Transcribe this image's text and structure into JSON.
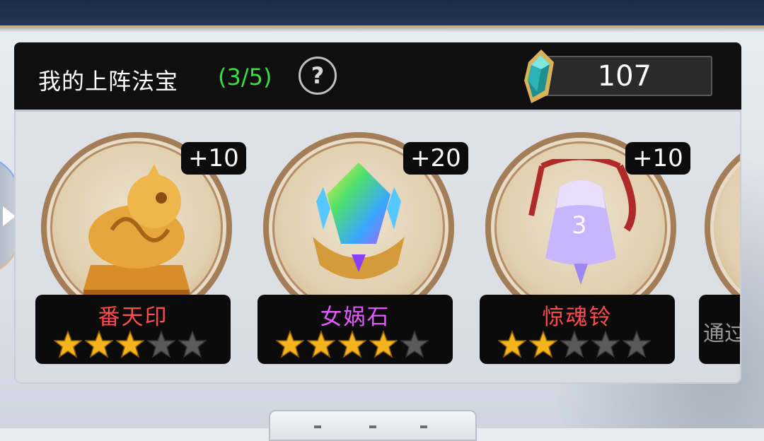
{
  "header": {
    "title": "我的上阵法宝",
    "count": "(3/5)",
    "help_symbol": "?",
    "currency": {
      "icon": "gem-icon",
      "value": "107"
    }
  },
  "treasures": [
    {
      "name": "番天印",
      "name_color": "#ff4d4d",
      "bonus": "+10",
      "stars_filled": 3,
      "stars_total": 5,
      "icon": "seal-icon"
    },
    {
      "name": "女娲石",
      "name_color": "#e35bff",
      "bonus": "+20",
      "stars_filled": 4,
      "stars_total": 5,
      "icon": "crystal-icon"
    },
    {
      "name": "惊魂铃",
      "name_color": "#ff4d4d",
      "bonus": "+10",
      "stars_filled": 2,
      "stars_total": 5,
      "icon": "bell-icon"
    }
  ],
  "partial_item": {
    "label": "通过"
  },
  "colors": {
    "count_green": "#39e03c",
    "star_gold": "#f5b41d",
    "star_gray": "#5a5a5a"
  }
}
